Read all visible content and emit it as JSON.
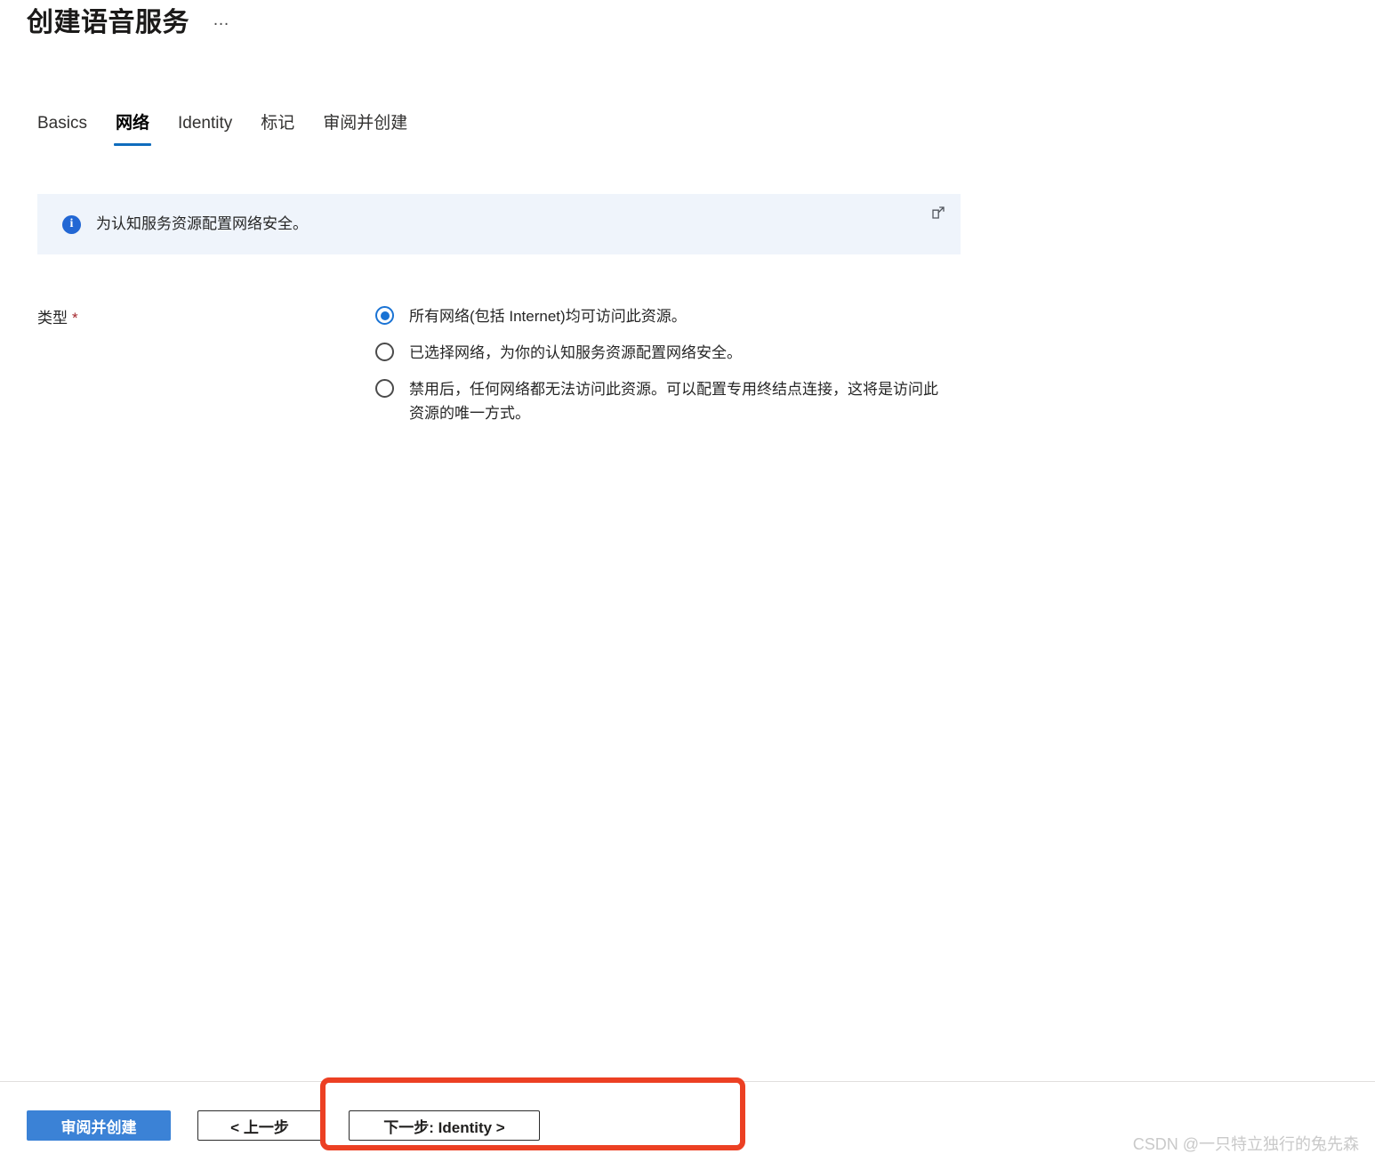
{
  "page": {
    "title": "创建语音服务",
    "ellipsis_menu": "…"
  },
  "tabs": [
    {
      "label": "Basics",
      "active": false
    },
    {
      "label": "网络",
      "active": true
    },
    {
      "label": "Identity",
      "active": false
    },
    {
      "label": "标记",
      "active": false
    },
    {
      "label": "审阅并创建",
      "active": false
    }
  ],
  "info_banner": {
    "icon": "info-icon",
    "text": "为认知服务资源配置网络安全。",
    "external_link_icon": "external-link-icon"
  },
  "form": {
    "type_field": {
      "label": "类型",
      "required_marker": "*",
      "options": [
        {
          "label": "所有网络(包括 Internet)均可访问此资源。",
          "selected": true
        },
        {
          "label": "已选择网络，为你的认知服务资源配置网络安全。",
          "selected": false
        },
        {
          "label": "禁用后，任何网络都无法访问此资源。可以配置专用终结点连接，这将是访问此资源的唯一方式。",
          "selected": false
        }
      ]
    }
  },
  "footer": {
    "review_create_label": "审阅并创建",
    "previous_label": "< 上一步",
    "next_label": "下一步: Identity >"
  },
  "annotation": {
    "highlight_color": "#ec4023"
  },
  "watermark": {
    "text": "CSDN @一只特立独行的兔先森"
  },
  "colors": {
    "accent": "#0f6cbd",
    "primary_button": "#3b82d6",
    "info_banner_bg": "#eff4fb",
    "required_star": "#a4262c"
  }
}
